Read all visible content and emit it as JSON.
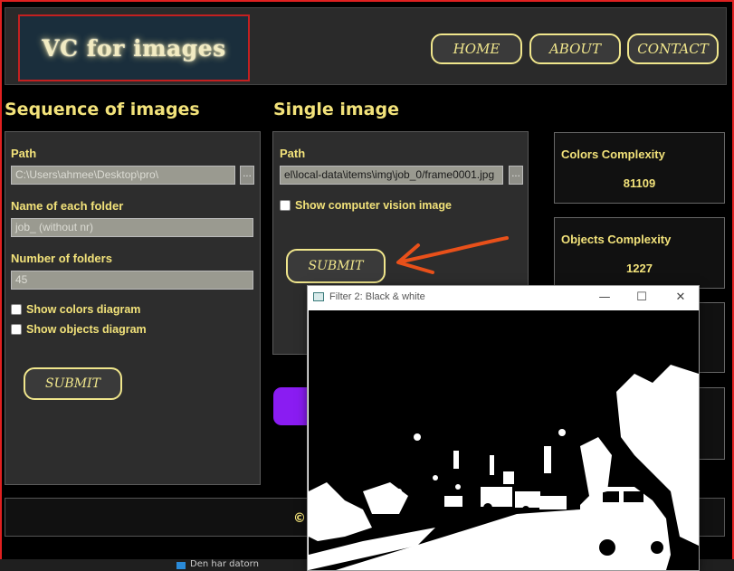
{
  "header": {
    "logo": "VC for images",
    "nav": [
      "HOME",
      "ABOUT",
      "CONTACT"
    ]
  },
  "sequence": {
    "title": "Sequence of images",
    "path_label": "Path",
    "path_value": "C:\\Users\\ahmee\\Desktop\\pro\\",
    "browse": "...",
    "folder_label": "Name of each folder",
    "folder_value": "job_   (without nr)",
    "count_label": "Number of folders",
    "count_value": "45",
    "colors_diagram": "Show colors diagram",
    "objects_diagram": "Show objects diagram",
    "submit": "SUBMIT"
  },
  "single": {
    "title": "Single image",
    "path_label": "Path",
    "path_value": "el\\local-data\\items\\img\\job_0/frame0001.jpg",
    "browse": "...",
    "cv_label": "Show computer vision image",
    "submit": "SUBMIT"
  },
  "metrics": [
    {
      "title": "Colors Complexity",
      "value": "81109"
    },
    {
      "title": "Objects Complexity",
      "value": "1227"
    }
  ],
  "footer": {
    "text": "©"
  },
  "taskbar": {
    "text": "Den har datorn"
  },
  "popup": {
    "title": "Filter 2: Black & white",
    "minimize": "—",
    "maximize": "☐",
    "close": "✕"
  },
  "colors": {
    "accent": "#f2e27a",
    "border_red": "#e02020",
    "purple": "#8a1cf2",
    "annotation_arrow": "#e8501a"
  }
}
